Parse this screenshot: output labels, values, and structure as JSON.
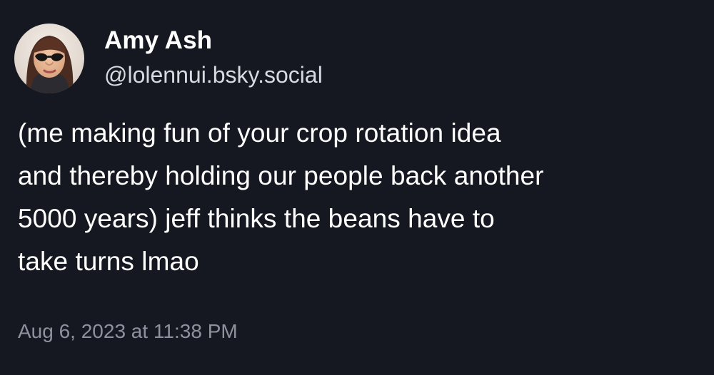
{
  "author": {
    "display_name": "Amy Ash",
    "handle": "@lolennui.bsky.social",
    "avatar": "user-avatar-photo"
  },
  "post": {
    "lines": [
      "(me making fun of your crop rotation idea",
      "and thereby holding our people back another",
      "5000 years) jeff thinks the beans have to",
      "take turns lmao"
    ],
    "timestamp": "Aug 6, 2023 at 11:38 PM"
  },
  "colors": {
    "background": "#151821",
    "primary_text": "#ffffff",
    "secondary_text": "#d7dae0",
    "timestamp_text": "#8d929e"
  }
}
